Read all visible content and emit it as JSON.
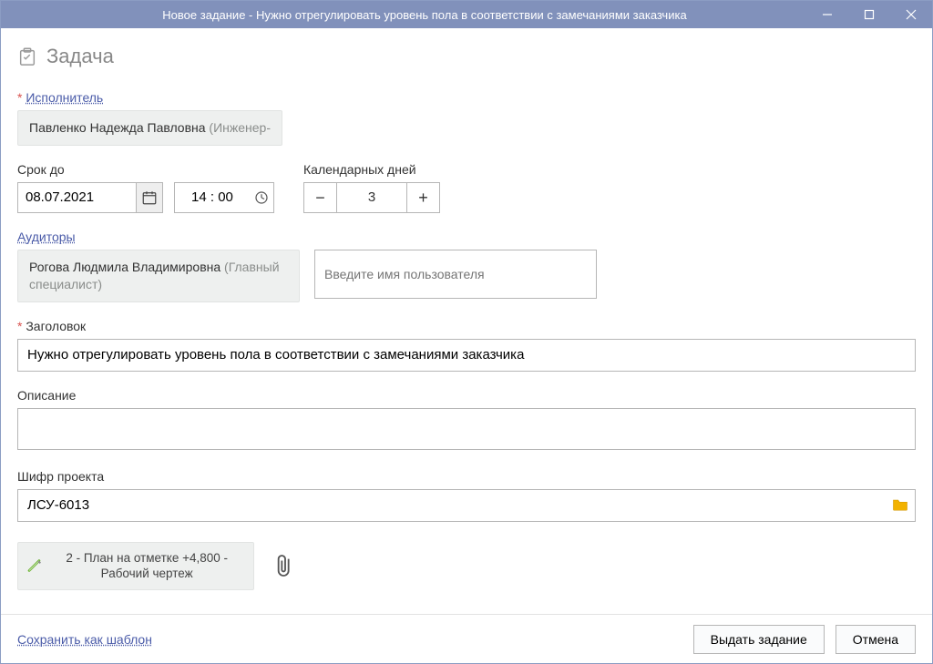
{
  "window": {
    "title": "Новое задание - Нужно отрегулировать уровень пола в соответствии с замечаниями заказчика"
  },
  "header": {
    "title": "Задача"
  },
  "executor": {
    "label": "Исполнитель",
    "name": "Павленко Надежда Павловна",
    "role": " (Инженер-"
  },
  "deadline": {
    "label": "Срок до",
    "date": "08.07.2021",
    "time": "14 : 00"
  },
  "calendar_days": {
    "label": "Календарных дней",
    "value": "3"
  },
  "auditors": {
    "label": "Аудиторы",
    "items": [
      {
        "name": "Рогова Людмила Владимировна",
        "role": " (Главный специалист)"
      }
    ],
    "add_placeholder": "Введите имя пользователя"
  },
  "title_field": {
    "label": "Заголовок",
    "value": "Нужно отрегулировать уровень пола в соответствии с замечаниями заказчика"
  },
  "description": {
    "label": "Описание",
    "value": ""
  },
  "project_code": {
    "label": "Шифр проекта",
    "value": "ЛСУ-6013"
  },
  "attachment": {
    "name": "2 - План на отметке +4,800 - Рабочий чертеж"
  },
  "footer": {
    "save_template": "Сохранить как шаблон",
    "submit": "Выдать задание",
    "cancel": "Отмена"
  }
}
